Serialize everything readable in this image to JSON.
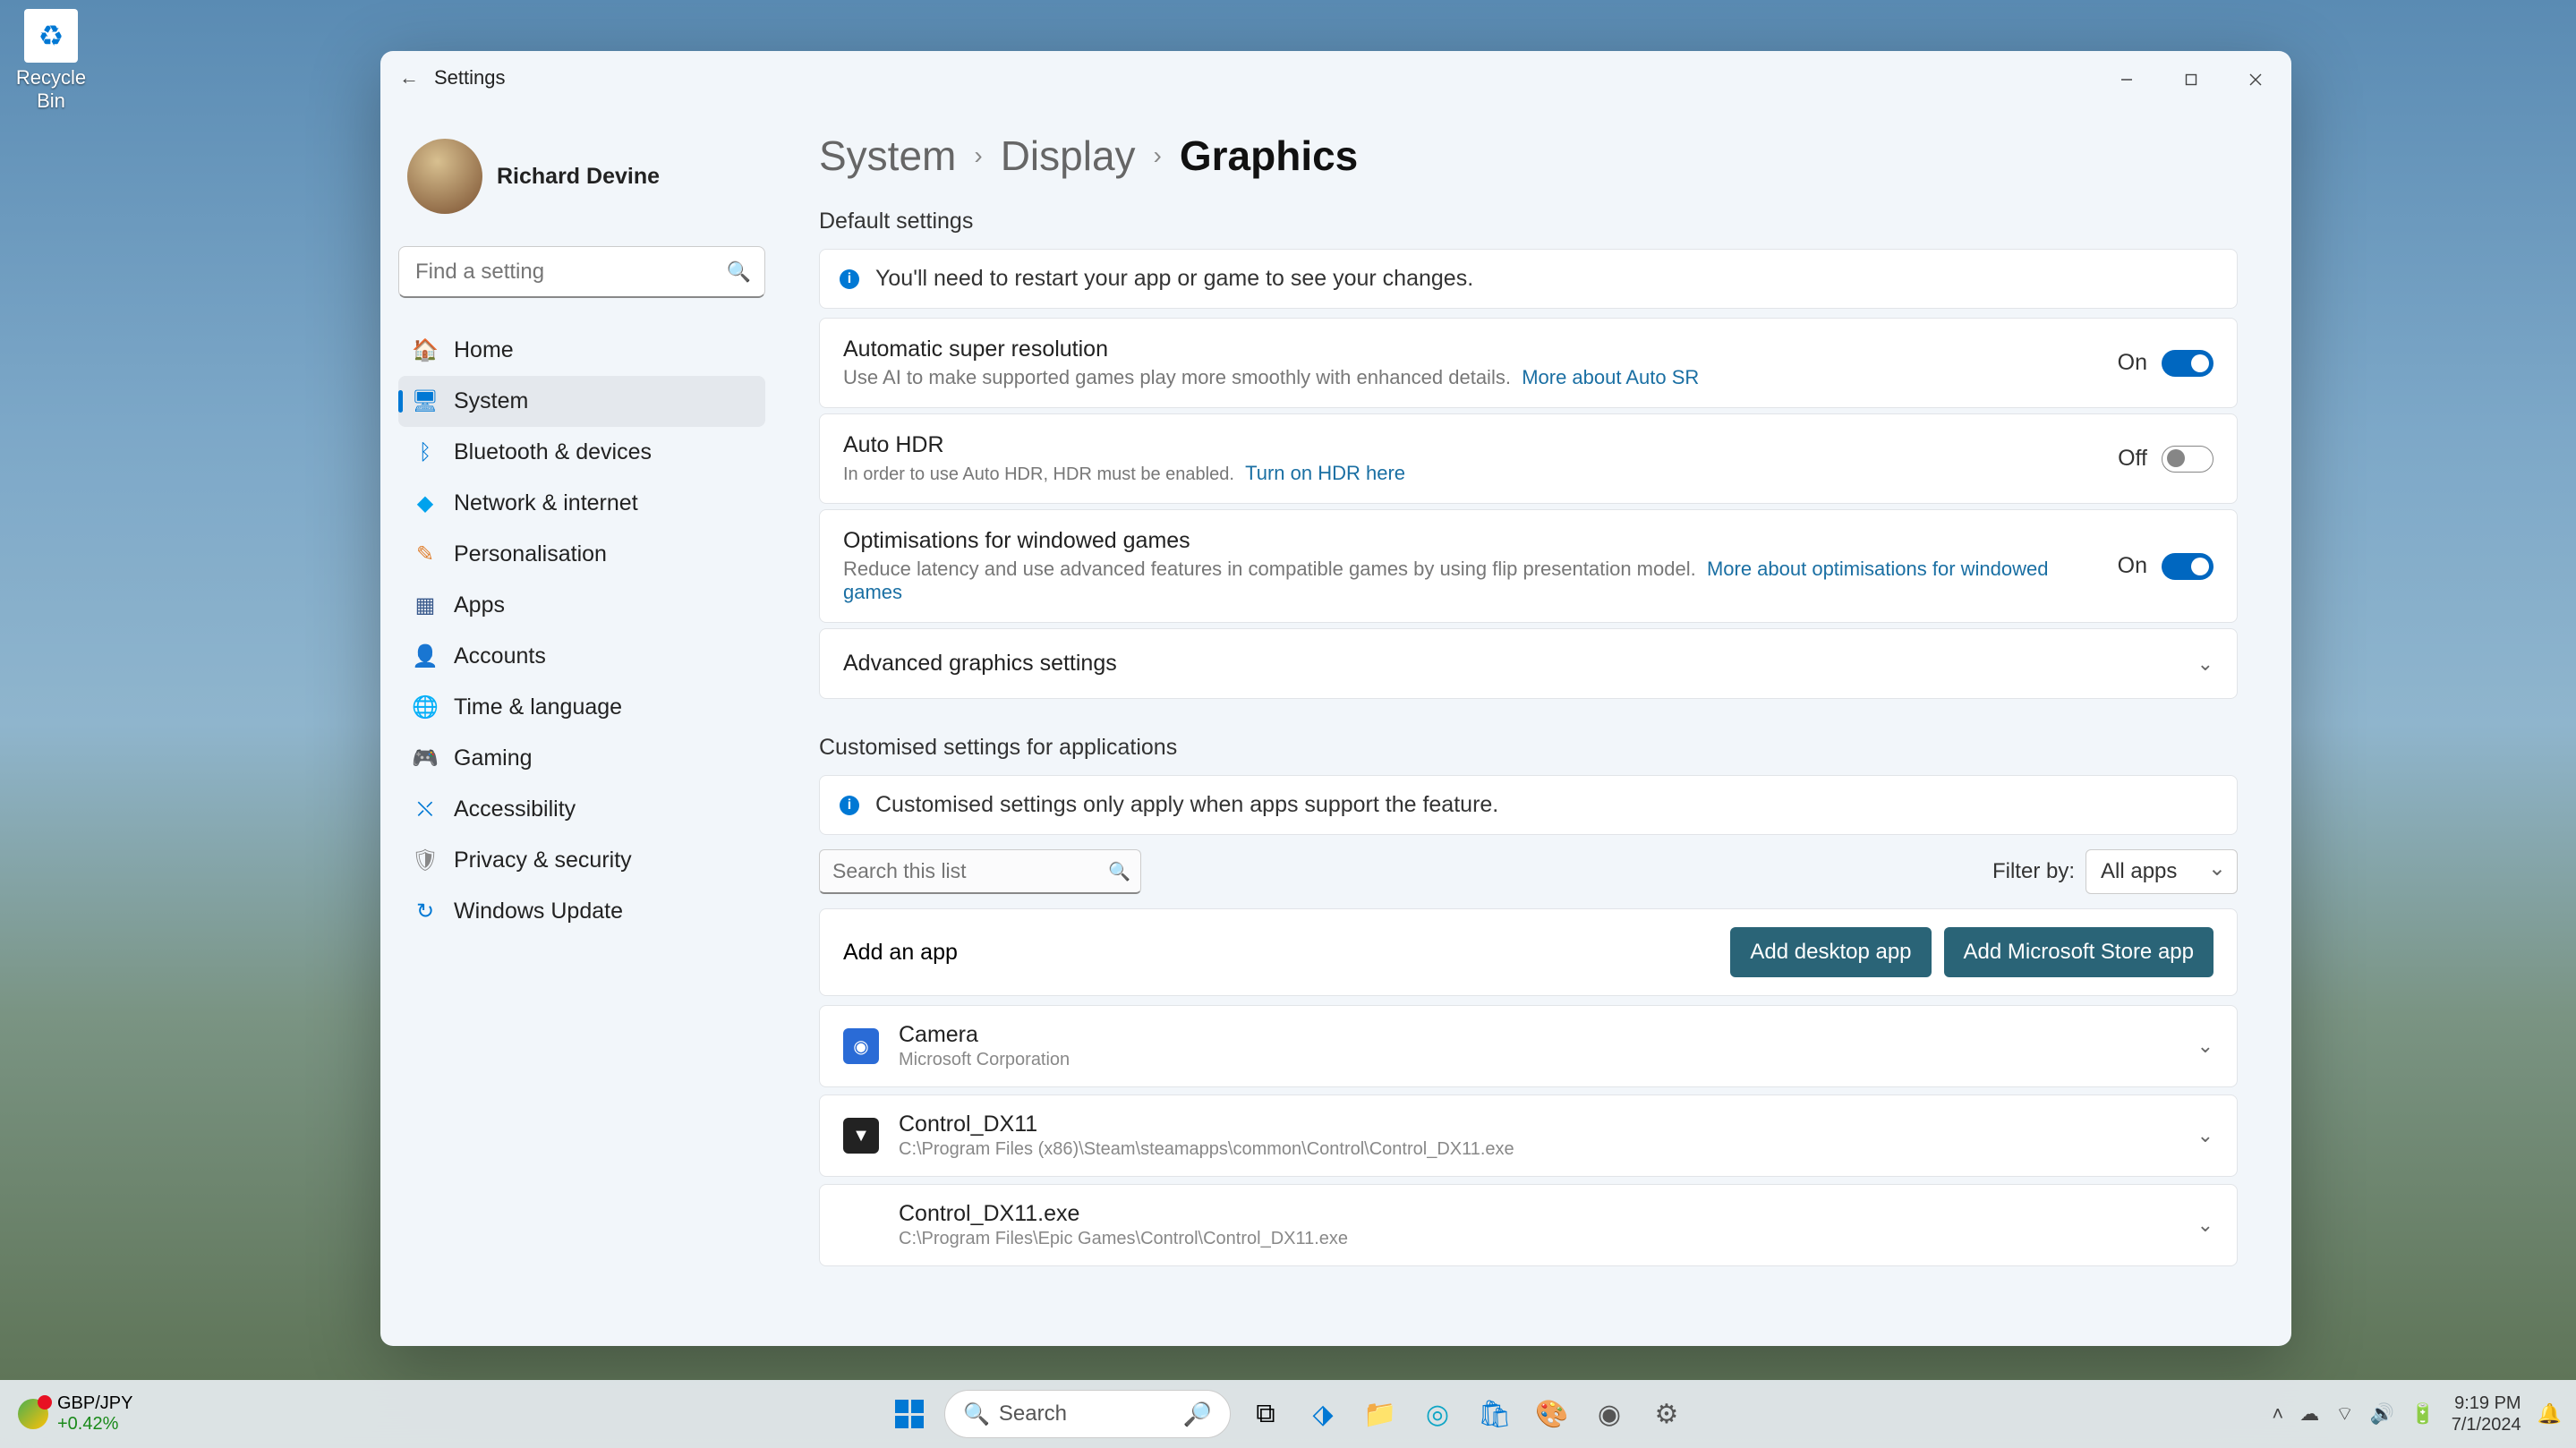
{
  "desktop": {
    "recycle_bin": "Recycle Bin"
  },
  "window": {
    "title": "Settings",
    "user_name": "Richard Devine",
    "search_placeholder": "Find a setting"
  },
  "nav": [
    {
      "icon": "🏠",
      "label": "Home",
      "color": "#e08030",
      "active": false
    },
    {
      "icon": "🖥",
      "label": "System",
      "color": "#0078d4",
      "active": true
    },
    {
      "icon": "ᛒ",
      "label": "Bluetooth & devices",
      "color": "#0078d4",
      "active": false
    },
    {
      "icon": "◆",
      "label": "Network & internet",
      "color": "#00a2ed",
      "active": false
    },
    {
      "icon": "✎",
      "label": "Personalisation",
      "color": "#e08030",
      "active": false
    },
    {
      "icon": "▦",
      "label": "Apps",
      "color": "#3a5a8c",
      "active": false
    },
    {
      "icon": "👤",
      "label": "Accounts",
      "color": "#1aab6a",
      "active": false
    },
    {
      "icon": "🌐",
      "label": "Time & language",
      "color": "#0078d4",
      "active": false
    },
    {
      "icon": "🎮",
      "label": "Gaming",
      "color": "#888",
      "active": false
    },
    {
      "icon": "⛌",
      "label": "Accessibility",
      "color": "#0078d4",
      "active": false
    },
    {
      "icon": "🛡",
      "label": "Privacy & security",
      "color": "#888",
      "active": false
    },
    {
      "icon": "↻",
      "label": "Windows Update",
      "color": "#0078d4",
      "active": false
    }
  ],
  "breadcrumb": {
    "a": "System",
    "b": "Display",
    "c": "Graphics"
  },
  "default_settings_title": "Default settings",
  "restart_banner": "You'll need to restart your app or game to see your changes.",
  "asr": {
    "title": "Automatic super resolution",
    "sub": "Use AI to make supported games play more smoothly with enhanced details.",
    "link": "More about Auto SR",
    "state": "On"
  },
  "hdr": {
    "title": "Auto HDR",
    "sub": "In order to use Auto HDR, HDR must be enabled.",
    "link": "Turn on HDR here",
    "state": "Off"
  },
  "opt": {
    "title": "Optimisations for windowed games",
    "sub": "Reduce latency and use advanced features in compatible games by using flip presentation model.",
    "link": "More about optimisations for windowed games",
    "state": "On"
  },
  "advanced": "Advanced graphics settings",
  "custom_title": "Customised settings for applications",
  "custom_banner": "Customised settings only apply when apps support the feature.",
  "list_search_placeholder": "Search this list",
  "filter_by_label": "Filter by:",
  "filter_value": "All apps",
  "add_app_label": "Add an app",
  "btn_desktop": "Add desktop app",
  "btn_store": "Add Microsoft Store app",
  "apps": [
    {
      "name": "Camera",
      "sub": "Microsoft Corporation",
      "bg": "#2a6bd6",
      "glyph": "◉"
    },
    {
      "name": "Control_DX11",
      "sub": "C:\\Program Files (x86)\\Steam\\steamapps\\common\\Control\\Control_DX11.exe",
      "bg": "#222",
      "glyph": "▼"
    },
    {
      "name": "Control_DX11.exe",
      "sub": "C:\\Program Files\\Epic Games\\Control\\Control_DX11.exe",
      "bg": "transparent",
      "glyph": ""
    }
  ],
  "taskbar": {
    "stock_symbol": "GBP/JPY",
    "stock_change": "+0.42%",
    "search": "Search",
    "time": "9:19 PM",
    "date": "7/1/2024"
  }
}
